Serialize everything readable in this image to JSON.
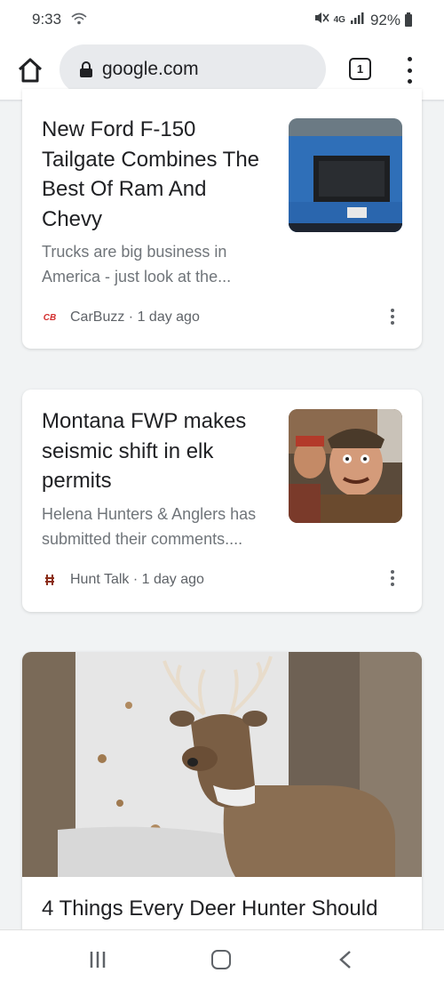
{
  "status_bar": {
    "time": "9:33",
    "network": "4G",
    "battery": "92%"
  },
  "browser": {
    "url": "google.com",
    "tab_count": "1"
  },
  "cards": [
    {
      "headline_lines": [
        "New Ford F-150",
        "Tailgate Combines The",
        "Best Of Ram And",
        "Chevy"
      ],
      "snippet_lines": [
        "Trucks are big business in",
        "America - just look at the..."
      ],
      "source_logo": "CB",
      "source": "CarBuzz · 1 day ago"
    },
    {
      "headline_lines": [
        "Montana FWP makes",
        "seismic shift in elk",
        "permits"
      ],
      "snippet_lines": [
        "Helena Hunters & Anglers has",
        "submitted their comments...."
      ],
      "source": "Hunt Talk · 1 day ago"
    },
    {
      "headline": "4 Things Every Deer Hunter Should"
    }
  ],
  "colors": {
    "background": "#f1f3f4",
    "card": "#ffffff",
    "text_primary": "#202124",
    "text_secondary": "#70757a",
    "brand_carbuzz": "#d32f2f"
  }
}
